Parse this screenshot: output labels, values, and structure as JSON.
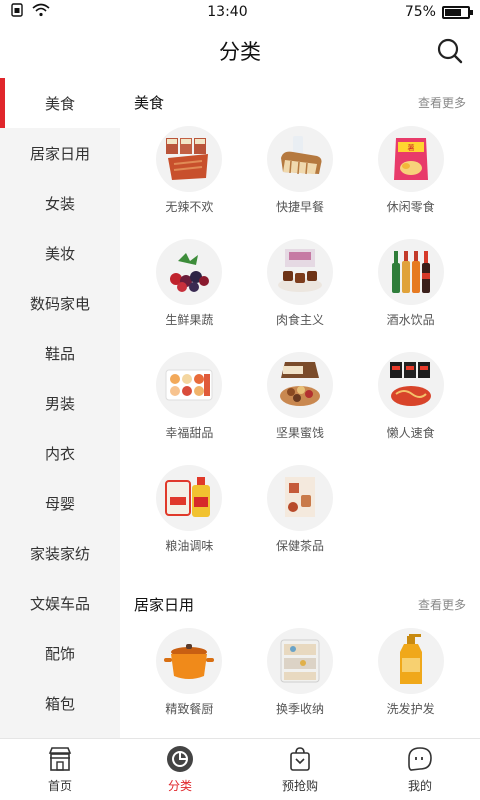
{
  "status": {
    "time": "13:40",
    "battery": "75%",
    "battery_level": 0.75
  },
  "nav": {
    "title": "分类"
  },
  "sidebar": {
    "items": [
      {
        "label": "美食",
        "active": true
      },
      {
        "label": "居家日用"
      },
      {
        "label": "女装"
      },
      {
        "label": "美妆"
      },
      {
        "label": "数码家电"
      },
      {
        "label": "鞋品"
      },
      {
        "label": "男装"
      },
      {
        "label": "内衣"
      },
      {
        "label": "母婴"
      },
      {
        "label": "家装家纺"
      },
      {
        "label": "文娱车品"
      },
      {
        "label": "配饰"
      },
      {
        "label": "箱包"
      }
    ]
  },
  "sections": [
    {
      "title": "美食",
      "more": "查看更多",
      "items": [
        {
          "label": "无辣不欢",
          "icon": "spicy-snacks-icon"
        },
        {
          "label": "快捷早餐",
          "icon": "bread-icon"
        },
        {
          "label": "休闲零食",
          "icon": "chips-bag-icon"
        },
        {
          "label": "生鲜果蔬",
          "icon": "berries-icon"
        },
        {
          "label": "肉食主义",
          "icon": "meat-icon"
        },
        {
          "label": "酒水饮品",
          "icon": "bottles-icon"
        },
        {
          "label": "幸福甜品",
          "icon": "macarons-icon"
        },
        {
          "label": "坚果蜜饯",
          "icon": "nuts-icon"
        },
        {
          "label": "懒人速食",
          "icon": "instant-noodles-icon"
        },
        {
          "label": "粮油调味",
          "icon": "rice-oil-icon"
        },
        {
          "label": "保健茶品",
          "icon": "tea-icon"
        }
      ]
    },
    {
      "title": "居家日用",
      "more": "查看更多",
      "items": [
        {
          "label": "精致餐厨",
          "icon": "pot-icon"
        },
        {
          "label": "换季收纳",
          "icon": "storage-drawer-icon"
        },
        {
          "label": "洗发护发",
          "icon": "shampoo-icon"
        }
      ]
    }
  ],
  "tabs": [
    {
      "label": "首页",
      "icon": "shop-icon"
    },
    {
      "label": "分类",
      "icon": "category-icon",
      "active": true
    },
    {
      "label": "预抢购",
      "icon": "shopping-bag-icon"
    },
    {
      "label": "我的",
      "icon": "profile-bubble-icon"
    }
  ],
  "colors": {
    "accent": "#e0262b",
    "sidebar_bg": "#f4f4f4"
  }
}
